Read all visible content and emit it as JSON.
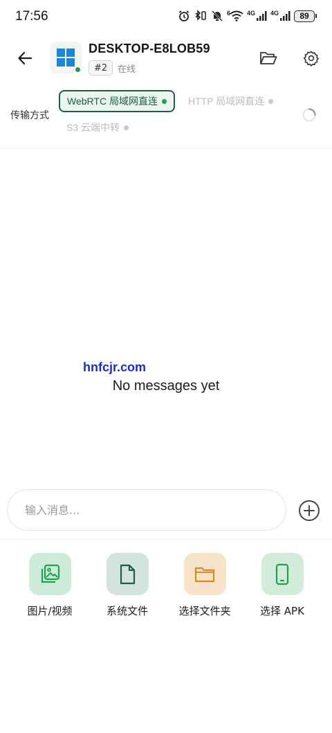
{
  "status_bar": {
    "time": "17:56",
    "network_label": "4G",
    "network_label_2": "4G",
    "wifi_badge": "6",
    "battery": "89"
  },
  "header": {
    "device_name": "DESKTOP-E8LOB59",
    "device_badge": "#2",
    "device_status": "在线",
    "back_icon": "arrow-left-icon",
    "folder_icon": "folder-open-icon",
    "settings_icon": "gear-icon"
  },
  "transport": {
    "label": "传输方式",
    "options": [
      {
        "label": "WebRTC 局域网直连",
        "active": true
      },
      {
        "label": "HTTP 局域网直连",
        "active": false
      },
      {
        "label": "S3 云端中转",
        "active": false
      }
    ]
  },
  "main": {
    "watermark": "hnfcjr.com",
    "empty_text": "No messages yet"
  },
  "composer": {
    "placeholder": "输入消息...",
    "add_icon": "plus-circle-icon"
  },
  "attachments": [
    {
      "label": "图片/视频",
      "icon": "images-icon",
      "color": "#1ea04f"
    },
    {
      "label": "系统文件",
      "icon": "file-icon",
      "color": "#1f5c42"
    },
    {
      "label": "选择文件夹",
      "icon": "folder-icon",
      "color": "#d98a1c"
    },
    {
      "label": "选择 APK",
      "icon": "phone-icon",
      "color": "#1ea04f"
    }
  ],
  "colors": {
    "accent": "#1f5c42",
    "online": "#1ea04f",
    "windows_blue": "#1a86d6"
  }
}
